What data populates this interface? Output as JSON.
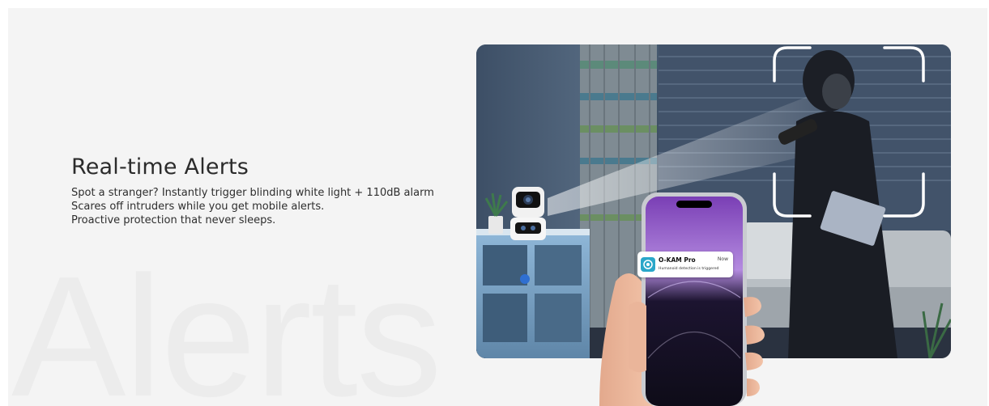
{
  "feature": {
    "title": "Real-time Alerts",
    "lines": [
      "Spot a stranger? Instantly trigger blinding white light + 110dB alarm",
      "Scares off intruders while you get mobile alerts.",
      "Proactive protection that never sleeps."
    ],
    "watermark": "Alerts"
  },
  "notification": {
    "app_name": "O-KAM Pro",
    "time": "Now",
    "message": "Humanoid detection is triggered",
    "icon": "o-kam-app-icon"
  },
  "colors": {
    "section_bg": "#f4f4f4",
    "title": "#2b2b2b",
    "watermark": "#ececec",
    "app_icon": "#2aa7c9"
  }
}
